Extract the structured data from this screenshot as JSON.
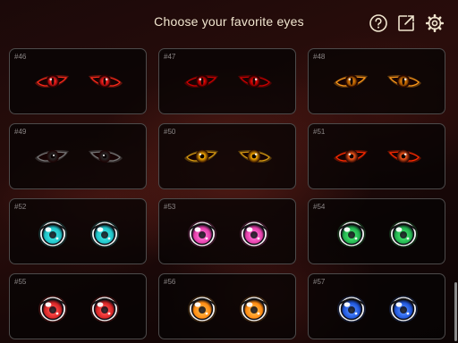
{
  "header": {
    "title": "Choose your favorite eyes",
    "icons": [
      "help-icon",
      "share-icon",
      "settings-icon"
    ]
  },
  "colors": {
    "title_text": "#f1e6cf",
    "card_border": "#4d4b4b",
    "number_text": "#8a8585"
  },
  "cards": [
    {
      "number": "#46",
      "style": "demon-sharp",
      "iris": "#ff1a1a",
      "glow": "#ff2a1a"
    },
    {
      "number": "#47",
      "style": "demon-sharp",
      "iris": "#e60000",
      "glow": "#cc0000"
    },
    {
      "number": "#48",
      "style": "demon-sharp",
      "iris": "#e07a00",
      "glow": "#ff9a1a"
    },
    {
      "number": "#49",
      "style": "shadow-almond",
      "iris": "#2a2a2a",
      "glow": "#777777"
    },
    {
      "number": "#50",
      "style": "glow-almond",
      "iris": "#ffb000",
      "glow": "#d79a12"
    },
    {
      "number": "#51",
      "style": "fire-almond",
      "iris": "#ff5a1a",
      "glow": "#ff2a00"
    },
    {
      "number": "#52",
      "style": "anime-round",
      "iris": "#1fc3c8",
      "glow": "#38e0e0"
    },
    {
      "number": "#53",
      "style": "anime-round",
      "iris": "#e23da8",
      "glow": "#ff6ad0"
    },
    {
      "number": "#54",
      "style": "anime-round",
      "iris": "#21b04e",
      "glow": "#3fe06a"
    },
    {
      "number": "#55",
      "style": "anime-round",
      "iris": "#d42424",
      "glow": "#ff4a4a"
    },
    {
      "number": "#56",
      "style": "anime-round",
      "iris": "#ff8a10",
      "glow": "#ffb040"
    },
    {
      "number": "#57",
      "style": "anime-round",
      "iris": "#1f55d8",
      "glow": "#4a84ff"
    }
  ]
}
